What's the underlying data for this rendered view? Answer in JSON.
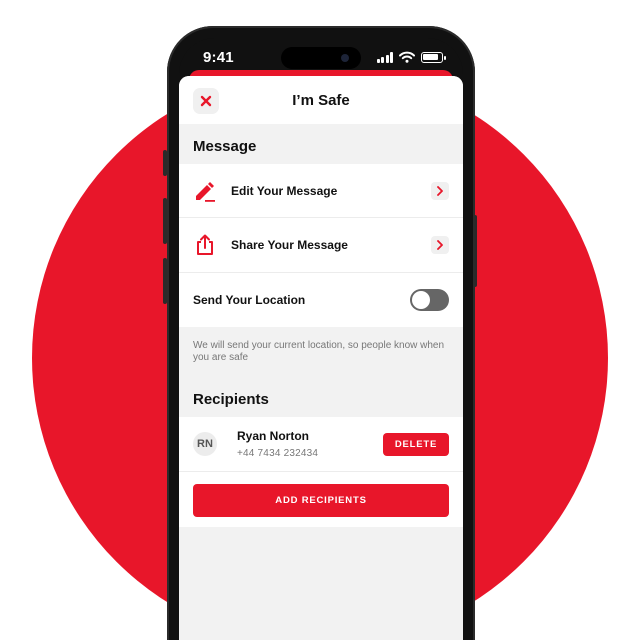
{
  "status_bar": {
    "time": "9:41"
  },
  "header": {
    "title": "I’m Safe",
    "close_icon": "close-x-icon"
  },
  "message_section": {
    "title": "Message",
    "items": [
      {
        "label": "Edit Your Message",
        "icon": "pencil-icon"
      },
      {
        "label": "Share Your Message",
        "icon": "share-icon"
      }
    ],
    "location": {
      "label": "Send Your Location",
      "enabled": false
    },
    "hint": "We will send your current location, so people know when you are safe"
  },
  "recipients_section": {
    "title": "Recipients",
    "list": [
      {
        "initials": "RN",
        "name": "Ryan Norton",
        "phone": "+44 7434 232434",
        "delete_label": "DELETE"
      }
    ],
    "add_label": "ADD RECIPIENTS"
  },
  "colors": {
    "accent": "#e8162a",
    "background": "#f2f2f2",
    "toggle_off": "#666666"
  }
}
